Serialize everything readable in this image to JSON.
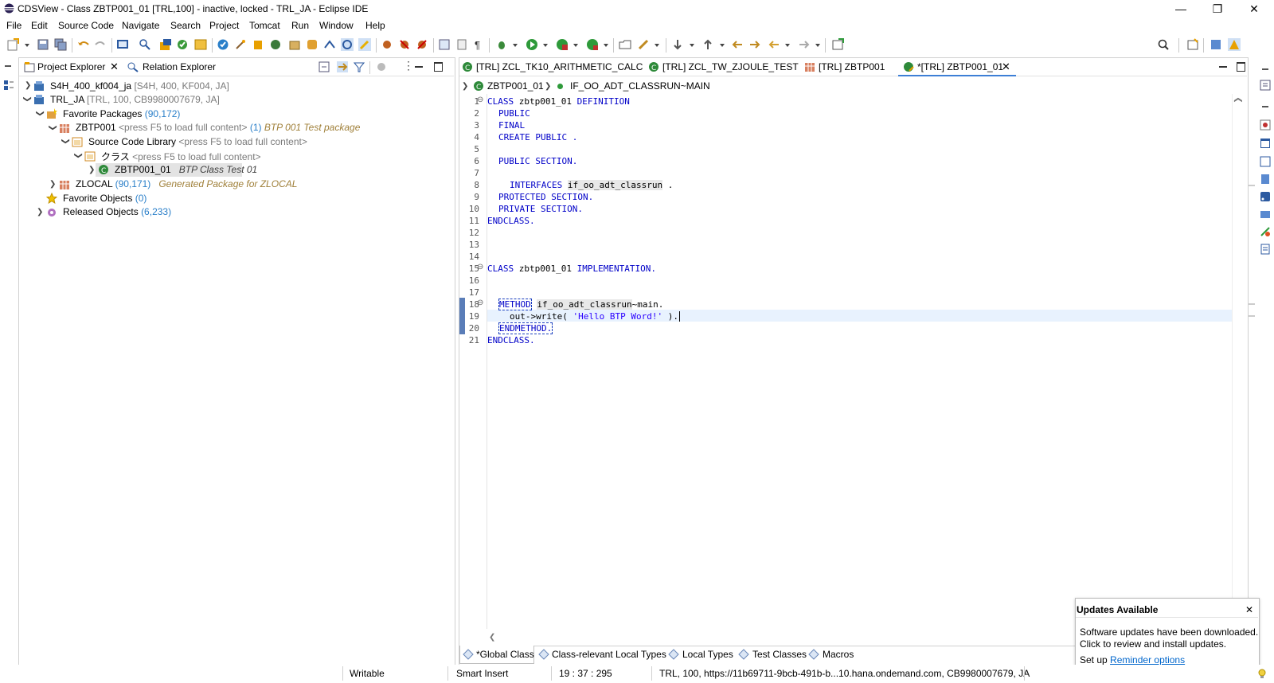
{
  "window": {
    "title": "CDSView - Class ZBTP001_01 [TRL,100] - inactive, locked - TRL_JA - Eclipse IDE",
    "minimize": "—",
    "restore": "❐",
    "close": "✕"
  },
  "menu": [
    "File",
    "Edit",
    "Source Code",
    "Navigate",
    "Search",
    "Project",
    "Tomcat",
    "Run",
    "Window",
    "Help"
  ],
  "left_panel": {
    "tabs": [
      {
        "label": "Project Explorer",
        "close": "✕"
      },
      {
        "label": "Relation Explorer"
      }
    ],
    "tree": [
      {
        "name": "S4H_400_kf004_ja",
        "detail": "[S4H, 400, KF004, JA]"
      },
      {
        "name": "TRL_JA",
        "detail": "[TRL, 100, CB9980007679, JA]"
      },
      {
        "name": "Favorite Packages",
        "count": "(90,172)"
      },
      {
        "name": "ZBTP001",
        "hint": "<press F5 to load full content>",
        "count": "(1)",
        "desc": "BTP 001 Test package"
      },
      {
        "name": "Source Code Library",
        "hint": "<press F5 to load full content>"
      },
      {
        "name": "クラス",
        "hint": "<press F5 to load full content>"
      },
      {
        "name": "ZBTP001_01",
        "desc": "BTP Class Test 01"
      },
      {
        "name": "ZLOCAL",
        "count": "(90,171)",
        "desc": "Generated Package for ZLOCAL"
      },
      {
        "name": "Favorite Objects",
        "count": "(0)"
      },
      {
        "name": "Released Objects",
        "count": "(6,233)"
      }
    ]
  },
  "editor": {
    "tabs": [
      {
        "label": "[TRL] ZCL_TK10_ARITHMETIC_CALC"
      },
      {
        "label": "[TRL] ZCL_TW_ZJOULE_TEST"
      },
      {
        "label": "[TRL] ZBTP001"
      },
      {
        "label": "*[TRL] ZBTP001_01",
        "active": true,
        "close": "✕"
      }
    ],
    "breadcrumb": [
      "ZBTP001_01",
      "IF_OO_ADT_CLASSRUN~MAIN"
    ],
    "line_numbers": [
      "1",
      "2",
      "3",
      "4",
      "5",
      "6",
      "7",
      "8",
      "9",
      "10",
      "11",
      "12",
      "13",
      "14",
      "15",
      "16",
      "17",
      "18",
      "19",
      "20",
      "21"
    ],
    "code": {
      "l1": [
        "CLASS",
        " zbtp001_01 ",
        "DEFINITION"
      ],
      "l2": "PUBLIC",
      "l3": "FINAL",
      "l4": "CREATE PUBLIC .",
      "l6": "PUBLIC SECTION.",
      "l8": [
        "INTERFACES",
        "if_oo_adt_classrun",
        " ."
      ],
      "l9": "PROTECTED SECTION.",
      "l10": "PRIVATE SECTION.",
      "l11": "ENDCLASS.",
      "l15": [
        "CLASS",
        " zbtp001_01 ",
        "IMPLEMENTATION."
      ],
      "l18": [
        "METHOD",
        "if_oo_adt_classrun",
        "~main."
      ],
      "l19": [
        "out->write( ",
        "'Hello BTP Word!'",
        " )."
      ],
      "l20": "ENDMETHOD.",
      "l21": "ENDCLASS."
    },
    "bottom_tabs": [
      "*Global Class",
      "Class-relevant Local Types",
      "Local Types",
      "Test Classes",
      "Macros"
    ]
  },
  "notification": {
    "title": "Updates Available",
    "close": "✕",
    "line1": "Software updates have been downloaded.",
    "line2": "Click to review and install updates.",
    "setup_prefix": "Set up",
    "link": "Reminder options"
  },
  "status": {
    "writable": "Writable",
    "insert": "Smart Insert",
    "position": "19 : 37 : 295",
    "system": "TRL, 100, https://11b69711-9bcb-491b-b...10.hana.ondemand.com, CB9980007679, JA"
  },
  "colors": {
    "keyword": "#0000c8",
    "string": "#2a00ff",
    "link": "#0066cc",
    "count": "#2a7fc9",
    "active_tab_underline": "#3d7fd6"
  }
}
